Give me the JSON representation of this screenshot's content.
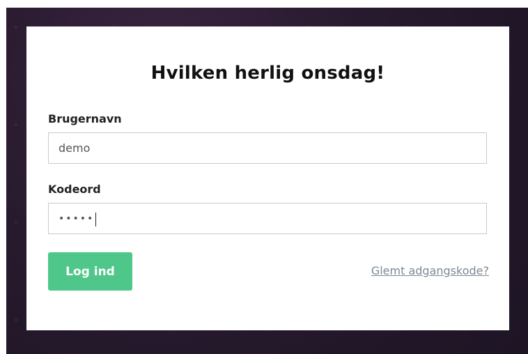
{
  "login": {
    "title": "Hvilken herlig onsdag!",
    "username_label": "Brugernavn",
    "username_value": "demo",
    "password_label": "Kodeord",
    "password_mask": "•••••",
    "submit_label": "Log ind",
    "forgot_link": "Glemt adgangskode?"
  },
  "colors": {
    "accent": "#4fc78a",
    "background": "#271a2e",
    "link": "#7b8793"
  }
}
